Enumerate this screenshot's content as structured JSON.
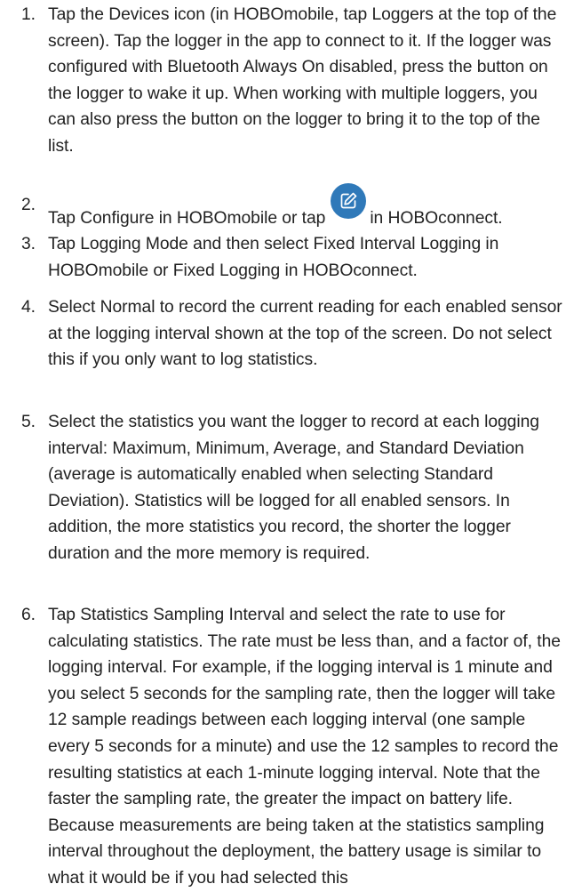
{
  "steps": [
    {
      "number": "1.",
      "text": "Tap the Devices icon (in HOBOmobile, tap Loggers at the top of the screen). Tap the logger in the app to connect to it. If the logger was configured with Bluetooth Always On disabled, press the button on the logger to wake it up. When working with multiple loggers, you can also press the button on the logger to bring it to the top of the list."
    },
    {
      "number": "2.",
      "text_before_icon": "Tap Configure in HOBOmobile or tap",
      "icon": "edit-pencil-icon",
      "text_after_icon": "in HOBOconnect."
    },
    {
      "number": "3.",
      "text": "Tap Logging Mode and then select Fixed Interval Logging in HOBOmobile or Fixed Logging in HOBOconnect."
    },
    {
      "number": "4.",
      "text": "Select Normal to record the current reading for each enabled sensor at the logging interval shown at the top of the screen. Do not select this if you only want to log statistics."
    },
    {
      "number": "5.",
      "text": "Select the statistics you want the logger to record at each logging interval: Maximum, Minimum, Average, and Standard Deviation (average is automatically enabled when selecting Standard Deviation). Statistics will be logged for all enabled sensors. In addition, the more statistics you record, the shorter the logger duration and the more memory is required."
    },
    {
      "number": "6.",
      "text": "Tap Statistics Sampling Interval and select the rate to use for calculating statistics. The rate must be less than, and a factor of, the logging interval. For example, if the logging interval is 1 minute and you select 5 seconds for the sampling rate, then the logger will take 12 sample readings between each logging interval (one sample every 5 seconds for a minute) and use the 12 samples to record the resulting statistics at each 1-minute logging interval. Note that the faster the sampling rate, the greater the impact on battery life. Because measurements are being taken at the statistics sampling interval throughout the deployment, the battery usage is similar to what it would be if you had selected this"
    }
  ],
  "colors": {
    "text": "#222222",
    "icon_background": "#2f79b9",
    "icon_foreground": "#ffffff"
  }
}
